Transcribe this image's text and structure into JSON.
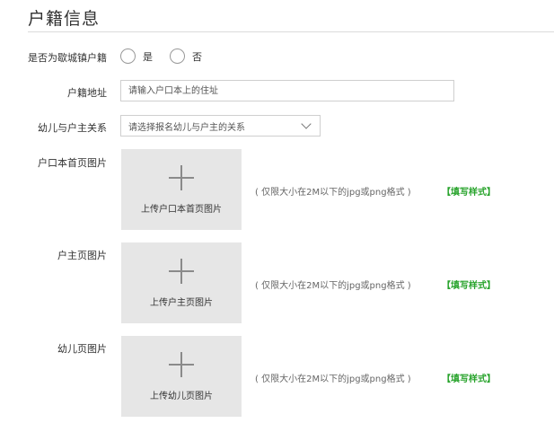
{
  "page": {
    "title": "户籍信息"
  },
  "fields": {
    "local_hukou": {
      "label": "是否为歇城镇户籍",
      "option_yes": "是",
      "option_no": "否"
    },
    "address": {
      "label": "户籍地址",
      "placeholder": "请输入户口本上的住址"
    },
    "relation": {
      "label": "幼儿与户主关系",
      "placeholder": "请选择报名幼儿与户主的关系"
    }
  },
  "uploads": [
    {
      "label": "户口本首页图片",
      "button_text": "上传户口本首页图片"
    },
    {
      "label": "户主页图片",
      "button_text": "上传户主页图片"
    },
    {
      "label": "幼儿页图片",
      "button_text": "上传幼儿页图片"
    }
  ],
  "hint": "( 仅限大小在2M以下的jpg或png格式 )",
  "sample_link": "【填写样式】",
  "colors": {
    "sample_link": "#27a32b",
    "upload_bg": "#e6e6e6"
  }
}
